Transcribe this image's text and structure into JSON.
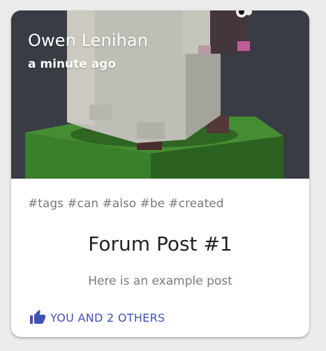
{
  "post": {
    "author": "Owen Lenihan",
    "timestamp": "a minute ago",
    "tags": "#tags #can #also #be #created",
    "title": "Forum Post #1",
    "body": "Here is an example post",
    "like_label": "YOU AND 2 OTHERS",
    "like_icon": "thumbs-up-icon",
    "accent_color": "#3f51b5"
  }
}
